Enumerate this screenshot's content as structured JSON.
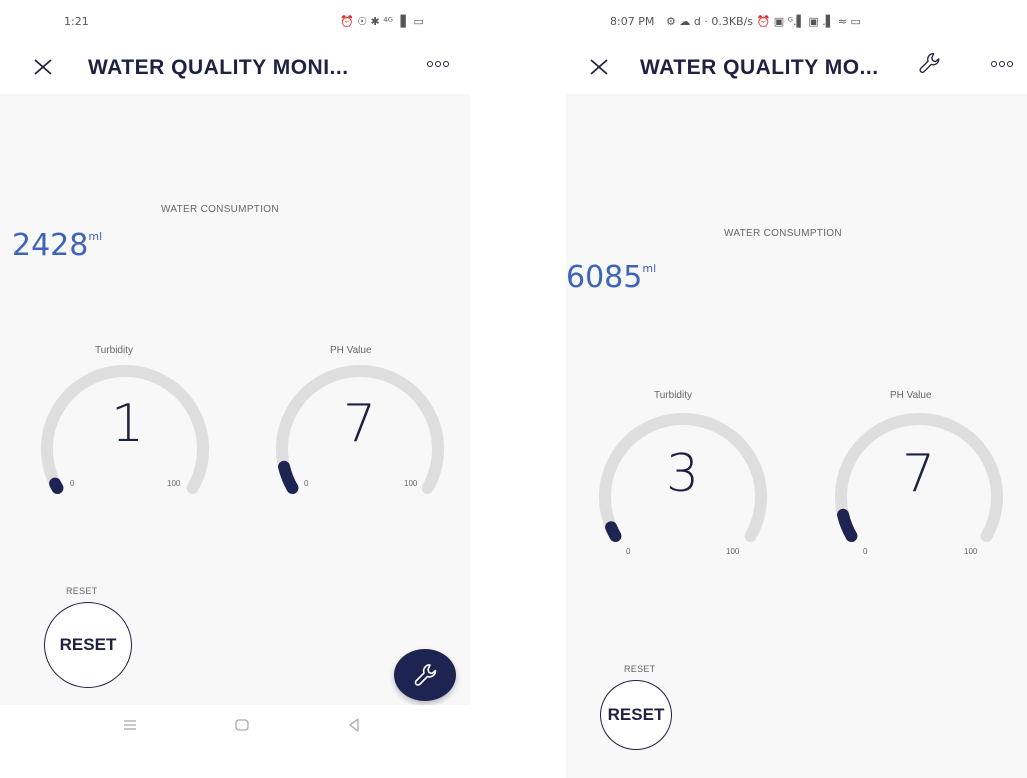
{
  "colors": {
    "accent_blue": "#3d64b8",
    "navy": "#1d2240",
    "gauge_track": "#dedede",
    "gauge_fill": "#1d2452",
    "background": "#f8f8f9"
  },
  "left_phone": {
    "status": {
      "time": "1:21",
      "icons_text": "⏰ ☉ ✱ ⁴ᴳ▕▌ ▭"
    },
    "app_bar": {
      "title": "WATER QUALITY MONI...",
      "close_icon": "close-icon",
      "more_icon": "more-icon"
    },
    "consumption": {
      "label": "WATER CONSUMPTION",
      "value": "2428",
      "unit": "ml"
    },
    "turbidity": {
      "title": "Turbidity",
      "value": "1",
      "min": "0",
      "max": "100",
      "level": 1
    },
    "ph": {
      "title": "PH Value",
      "value": "7",
      "min": "0",
      "max": "100",
      "level": 7
    },
    "reset": {
      "label": "RESET",
      "button": "RESET"
    },
    "fab_icon": "wrench-icon",
    "nav": {
      "menu_icon": "menu-icon",
      "home_icon": "home-icon",
      "back_icon": "back-icon"
    }
  },
  "right_phone": {
    "status": {
      "time": "8:07 PM",
      "icons_text": "⚙ ☁ d · 0.3KB/s ⏰ ▣ ᴳ.▌ ▣ .▌ ≈ ▭"
    },
    "app_bar": {
      "title": "WATER QUALITY MO...",
      "close_icon": "close-icon",
      "tool_icon": "wrench-icon",
      "more_icon": "more-icon"
    },
    "consumption": {
      "label": "WATER CONSUMPTION",
      "value": "6085",
      "unit": "ml"
    },
    "turbidity": {
      "title": "Turbidity",
      "value": "3",
      "min": "0",
      "max": "100",
      "level": 3
    },
    "ph": {
      "title": "PH Value",
      "value": "7",
      "min": "0",
      "max": "100",
      "level": 7
    },
    "reset": {
      "label": "RESET",
      "button": "RESET"
    }
  }
}
